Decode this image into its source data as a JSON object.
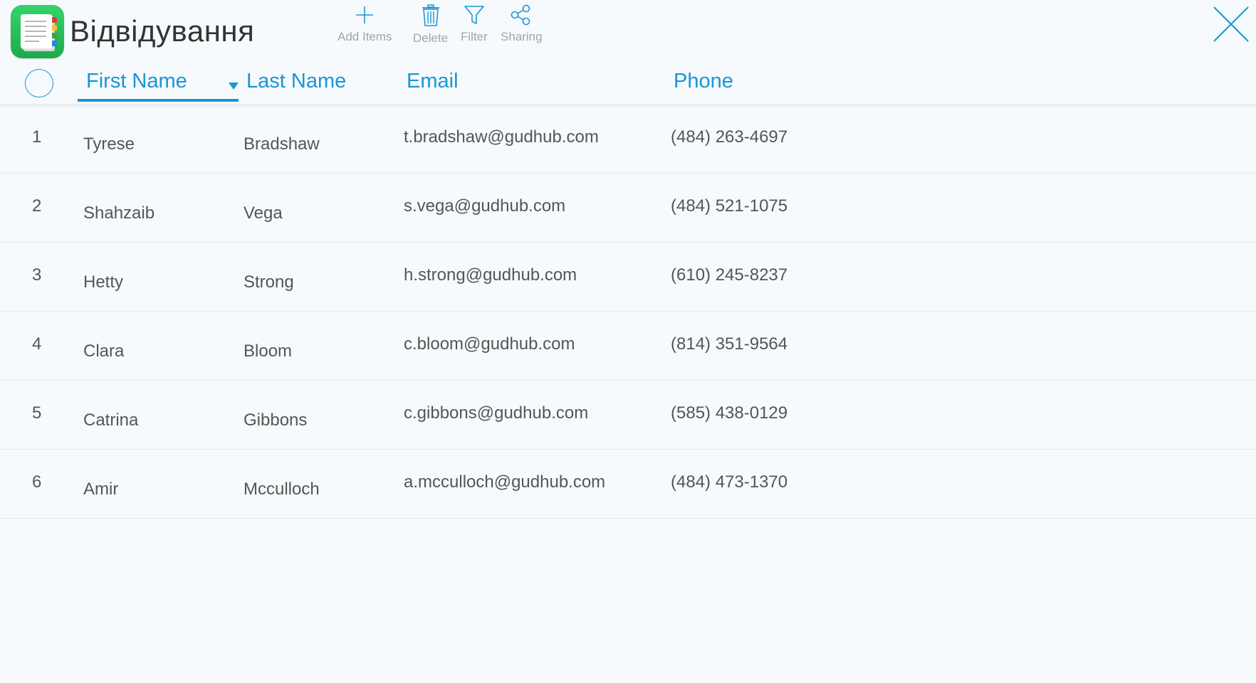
{
  "app": {
    "title": "Відвідування",
    "icon": "notebook-app-icon"
  },
  "toolbar": {
    "add_label": "Add Items",
    "delete_label": "Delete",
    "filter_label": "Filter",
    "sharing_label": "Sharing"
  },
  "table": {
    "columns": [
      "First Name",
      "Last Name",
      "Email",
      "Phone"
    ],
    "sorted_by": "Last Name",
    "rows": [
      {
        "n": "1",
        "first": "Tyrese",
        "last": "Bradshaw",
        "email": "t.bradshaw@gudhub.com",
        "phone": "(484) 263-4697"
      },
      {
        "n": "2",
        "first": "Shahzaib",
        "last": "Vega",
        "email": "s.vega@gudhub.com",
        "phone": "(484) 521-1075"
      },
      {
        "n": "3",
        "first": "Hetty",
        "last": "Strong",
        "email": "h.strong@gudhub.com",
        "phone": "(610) 245-8237"
      },
      {
        "n": "4",
        "first": "Clara",
        "last": "Bloom",
        "email": "c.bloom@gudhub.com",
        "phone": "(814) 351-9564"
      },
      {
        "n": "5",
        "first": "Catrina",
        "last": "Gibbons",
        "email": "c.gibbons@gudhub.com",
        "phone": "(585) 438-0129"
      },
      {
        "n": "6",
        "first": "Amir",
        "last": "Mcculloch",
        "email": "a.mcculloch@gudhub.com",
        "phone": "(484) 473-1370"
      }
    ]
  },
  "colors": {
    "accent": "#1996d4",
    "text": "#555555",
    "muted": "#9aa6ae",
    "background": "#f6fafd"
  }
}
